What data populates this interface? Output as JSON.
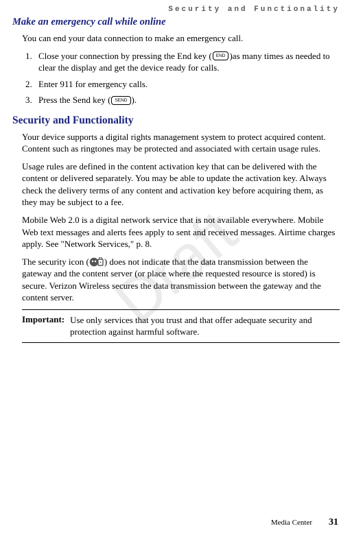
{
  "header": {
    "running": "Security and Functionality"
  },
  "emergency": {
    "title": "Make an emergency call while online",
    "intro": "You can end your data connection to make an emergency call.",
    "steps": [
      {
        "pre": "Close your connection by pressing the End key (",
        "key": "END",
        "post": ")as many times as needed to clear the display and get the device ready for calls."
      },
      {
        "pre": "Enter 911 for emergency calls.",
        "key": "",
        "post": ""
      },
      {
        "pre": "Press the Send key (",
        "key": "SEND",
        "post": ")."
      }
    ]
  },
  "security": {
    "title": "Security and Functionality",
    "paras": [
      "Your device supports a digital rights management system to protect acquired content. Content such as ringtones may be protected and associated with certain usage rules.",
      "Usage rules are defined in the content activation key that can be delivered with the content or delivered separately. You may be able to update the activation key. Always check the delivery terms of any content and activation key before acquiring them, as they may be subject to a fee.",
      "Mobile Web 2.0 is a digital network service that is not available everywhere. Mobile Web text messages and alerts fees apply to sent and received messages. Airtime charges apply. See \"Network Services,\" p. 8."
    ],
    "sec_icon_pre": "The security icon (",
    "sec_icon_post": ") does not indicate that the data transmission between the gateway and the content server (or place where the requested resource is stored) is secure. Verizon Wireless secures the data transmission between the gateway and the content server."
  },
  "important": {
    "label": "Important:",
    "text": "Use only services that you trust and that offer adequate security and protection against harmful software."
  },
  "watermark": "Draft",
  "footer": {
    "section": "Media Center",
    "page": "31"
  }
}
